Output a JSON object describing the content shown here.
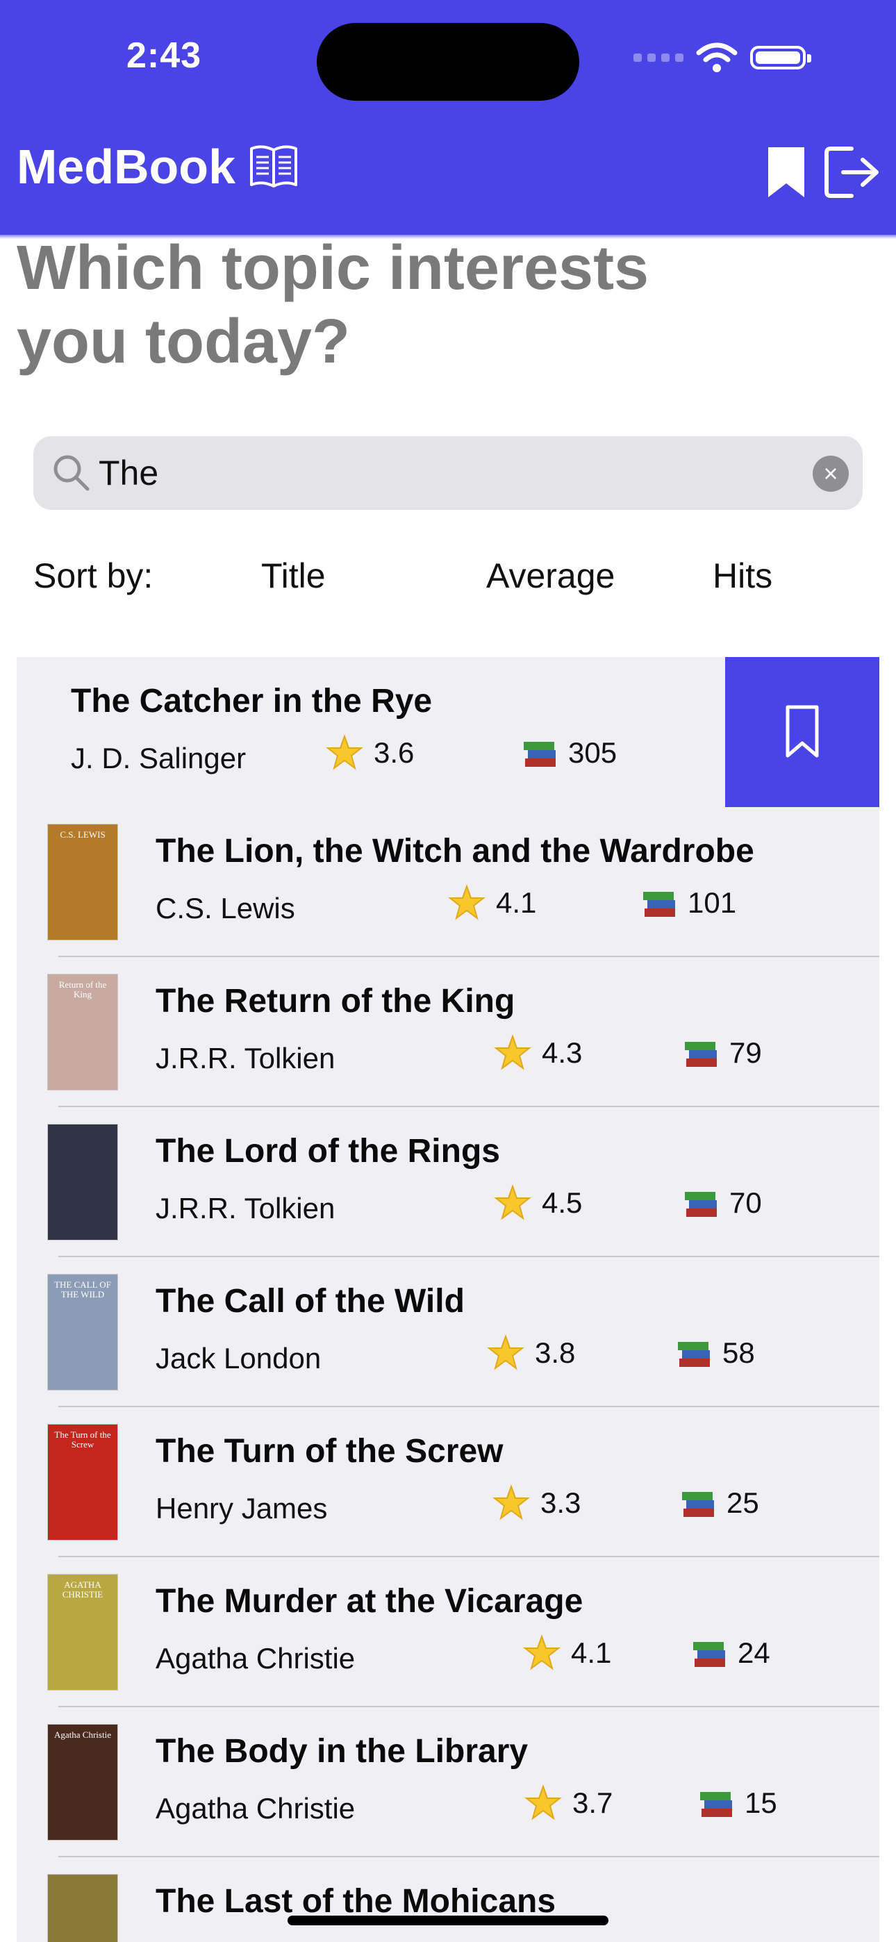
{
  "status_bar": {
    "time": "2:43"
  },
  "header": {
    "app_title": "MedBook"
  },
  "headline": {
    "line1": "Which topic interests",
    "line2": "you today?"
  },
  "search": {
    "value": "The"
  },
  "sort": {
    "label": "Sort by:",
    "options": [
      "Title",
      "Average",
      "Hits"
    ]
  },
  "books": [
    {
      "title": "The Catcher in the Rye",
      "author": "J. D. Salinger",
      "rating": "3.6",
      "hits": "305"
    },
    {
      "title": "The Lion, the Witch and the Wardrobe",
      "author": "C.S. Lewis",
      "rating": "4.1",
      "hits": "101",
      "cover_color": "#b47a2a",
      "cover_text": "C.S. LEWIS"
    },
    {
      "title": "The Return of the King",
      "author": "J.R.R. Tolkien",
      "rating": "4.3",
      "hits": "79",
      "cover_color": "#c9aaa0",
      "cover_text": "Return of the King"
    },
    {
      "title": "The Lord of the Rings",
      "author": "J.R.R. Tolkien",
      "rating": "4.5",
      "hits": "70",
      "cover_color": "#2f3546"
    },
    {
      "title": "The Call of the Wild",
      "author": "Jack London",
      "rating": "3.8",
      "hits": "58",
      "cover_color": "#8b9cb6",
      "cover_text": "THE CALL OF THE WILD"
    },
    {
      "title": "The Turn of the Screw",
      "author": "Henry James",
      "rating": "3.3",
      "hits": "25",
      "cover_color": "#c2261d",
      "cover_text": "The Turn of the Screw"
    },
    {
      "title": "The Murder at the Vicarage",
      "author": "Agatha Christie",
      "rating": "4.1",
      "hits": "24",
      "cover_color": "#b9a742",
      "cover_text": "AGATHA CHRISTIE"
    },
    {
      "title": "The Body in the Library",
      "author": "Agatha Christie",
      "rating": "3.7",
      "hits": "15",
      "cover_color": "#4a2a1c",
      "cover_text": "Agatha Christie"
    },
    {
      "title": "The Last of the Mohicans",
      "cover_color": "#8a7a3a"
    }
  ],
  "colors": {
    "accent": "#4a44e6",
    "list_bg": "#efeff4",
    "headline": "#7a7a7a"
  },
  "icons": [
    "book-icon",
    "bookmark-icon",
    "logout-icon",
    "search-icon",
    "clear-icon",
    "star-icon",
    "books-stack-icon"
  ]
}
